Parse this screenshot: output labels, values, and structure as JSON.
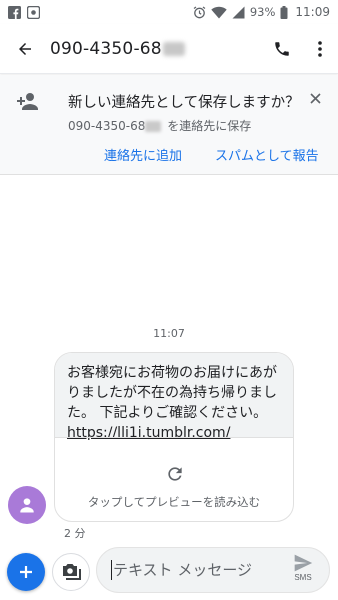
{
  "status_bar": {
    "battery": "93%",
    "time": "11:09"
  },
  "app_bar": {
    "phone_number": "090-4350-68"
  },
  "banner": {
    "title": "新しい連絡先として保存しますか？",
    "subtitle_number": "090-4350-68",
    "subtitle_suffix": " を連絡先に保存",
    "add_contact": "連絡先に追加",
    "report_spam": "スパムとして報告"
  },
  "conversation": {
    "timestamp": "11:07",
    "message_text": "お客様宛にお荷物のお届けにあがりましたが不在の為持ち帰りました。 下記よりご確認ください。",
    "message_link": "https://lli1i.tumblr.com/",
    "preview_label": "タップしてプレビューを読み込む",
    "message_age": "2 分"
  },
  "compose": {
    "placeholder": "テキスト メッセージ",
    "send_label": "SMS"
  },
  "colors": {
    "accent": "#1a73e8",
    "avatar": "#a97ad8"
  }
}
